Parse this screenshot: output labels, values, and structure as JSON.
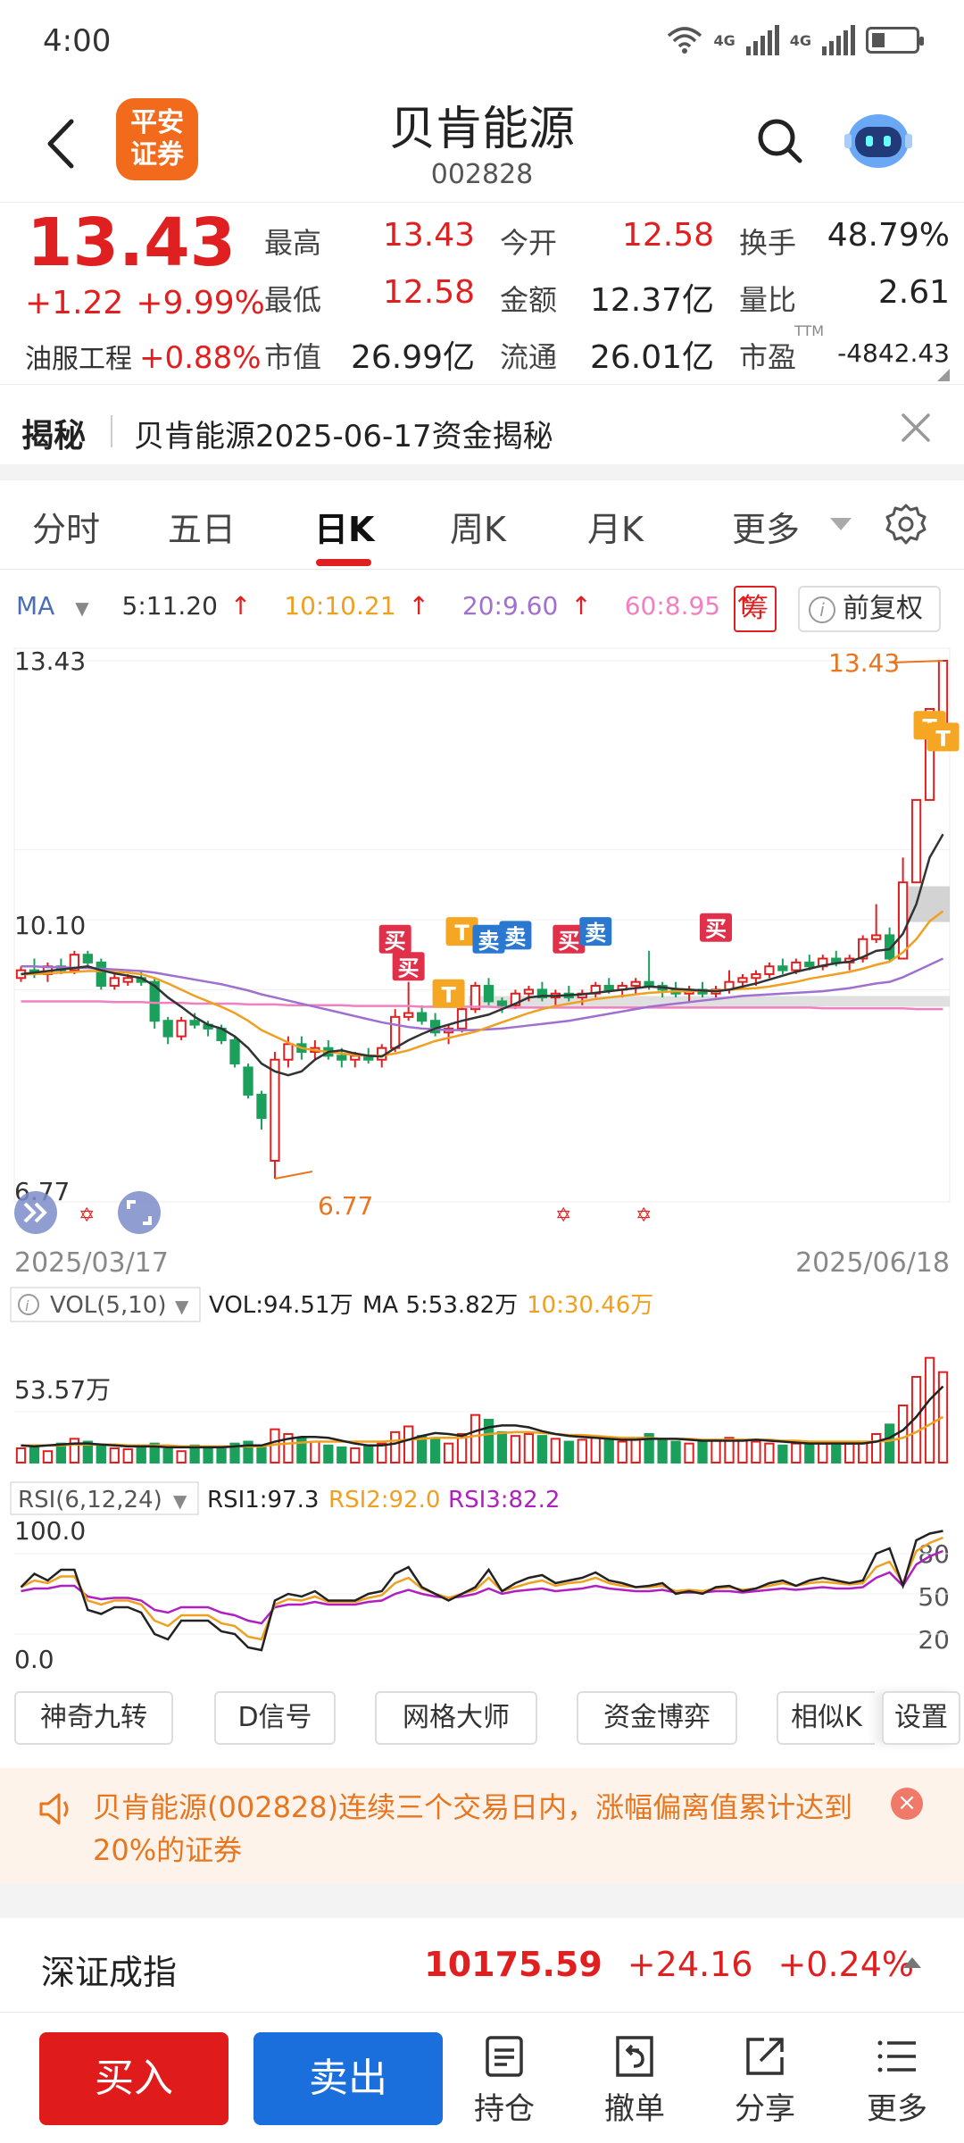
{
  "status": {
    "time": "4:00",
    "net1": "4G",
    "net2": "4G"
  },
  "header": {
    "logo_line1": "平安",
    "logo_line2": "证券",
    "title": "贝肯能源",
    "code": "002828"
  },
  "quote": {
    "price": "13.43",
    "change": "+1.22",
    "change_pct": "+9.99%",
    "sector_name": "油服工程",
    "sector_pct": "+0.88%",
    "fields": [
      {
        "label": "最高",
        "value": "13.43"
      },
      {
        "label": "今开",
        "value": "12.58"
      },
      {
        "label": "换手",
        "value": "48.79%"
      },
      {
        "label": "最低",
        "value": "12.58"
      },
      {
        "label": "金额",
        "value": "12.37亿"
      },
      {
        "label": "量比",
        "value": "2.61"
      },
      {
        "label": "市值",
        "value": "26.99亿"
      },
      {
        "label": "流通",
        "value": "26.01亿"
      },
      {
        "label": "市盈",
        "value": "-4842.43"
      }
    ],
    "pe_sup": "TTM"
  },
  "reveal": {
    "tag": "揭秘",
    "text": "贝肯能源2025-06-17资金揭秘"
  },
  "tabs": [
    "分时",
    "五日",
    "日K",
    "周K",
    "月K",
    "更多"
  ],
  "active_tab": "日K",
  "ma": {
    "label": "MA",
    "ma5": "5:11.20",
    "ma10": "10:10.21",
    "ma20": "20:9.60",
    "ma60": "60:8.95"
  },
  "chart_buttons": {
    "chip": "筹",
    "restore": "前复权"
  },
  "colors": {
    "up": "#e02020",
    "down": "#1aa05a",
    "ma5": "#333333",
    "ma10": "#f0a020",
    "ma20": "#a070d0",
    "ma60": "#f080c0"
  },
  "chart_data": {
    "type": "candlestick",
    "x_start": "2025/03/17",
    "x_end": "2025/06/18",
    "y_max_label": "13.43",
    "y_mid_label": "10.10",
    "y_min_label": "6.77",
    "high_marker": "13.43",
    "low_marker": "6.77",
    "ylim": [
      6.77,
      13.43
    ],
    "ohlc": [
      [
        9.35,
        9.5,
        9.3,
        9.45
      ],
      [
        9.45,
        9.6,
        9.35,
        9.4
      ],
      [
        9.4,
        9.55,
        9.3,
        9.5
      ],
      [
        9.5,
        9.6,
        9.4,
        9.45
      ],
      [
        9.45,
        9.7,
        9.4,
        9.65
      ],
      [
        9.65,
        9.7,
        9.5,
        9.55
      ],
      [
        9.55,
        9.6,
        9.2,
        9.25
      ],
      [
        9.25,
        9.4,
        9.2,
        9.35
      ],
      [
        9.3,
        9.4,
        9.25,
        9.35
      ],
      [
        9.35,
        9.45,
        9.25,
        9.3
      ],
      [
        9.3,
        9.35,
        8.7,
        8.8
      ],
      [
        8.8,
        8.85,
        8.5,
        8.6
      ],
      [
        8.6,
        8.85,
        8.55,
        8.8
      ],
      [
        8.8,
        8.9,
        8.7,
        8.75
      ],
      [
        8.75,
        8.8,
        8.6,
        8.7
      ],
      [
        8.7,
        8.75,
        8.5,
        8.55
      ],
      [
        8.55,
        8.6,
        8.2,
        8.25
      ],
      [
        8.2,
        8.25,
        7.8,
        7.85
      ],
      [
        7.85,
        7.9,
        7.4,
        7.55
      ],
      [
        7.0,
        8.4,
        6.77,
        8.3
      ],
      [
        8.3,
        8.6,
        8.2,
        8.5
      ],
      [
        8.5,
        8.6,
        8.3,
        8.4
      ],
      [
        8.4,
        8.55,
        8.3,
        8.45
      ],
      [
        8.45,
        8.55,
        8.3,
        8.35
      ],
      [
        8.35,
        8.45,
        8.2,
        8.3
      ],
      [
        8.3,
        8.4,
        8.2,
        8.35
      ],
      [
        8.35,
        8.45,
        8.25,
        8.3
      ],
      [
        8.3,
        8.5,
        8.2,
        8.45
      ],
      [
        8.45,
        8.95,
        8.4,
        8.85
      ],
      [
        8.85,
        9.3,
        8.8,
        8.9
      ],
      [
        8.9,
        9.0,
        8.75,
        8.8
      ],
      [
        8.8,
        8.9,
        8.6,
        8.65
      ],
      [
        8.65,
        8.75,
        8.5,
        8.7
      ],
      [
        8.7,
        9.0,
        8.65,
        8.95
      ],
      [
        8.95,
        9.3,
        8.9,
        9.25
      ],
      [
        9.25,
        9.35,
        9.0,
        9.05
      ],
      [
        9.05,
        9.1,
        8.9,
        9.0
      ],
      [
        9.0,
        9.2,
        8.95,
        9.15
      ],
      [
        9.15,
        9.25,
        9.05,
        9.2
      ],
      [
        9.2,
        9.3,
        9.05,
        9.1
      ],
      [
        9.1,
        9.2,
        9.0,
        9.15
      ],
      [
        9.15,
        9.25,
        9.05,
        9.1
      ],
      [
        9.1,
        9.2,
        9.0,
        9.15
      ],
      [
        9.15,
        9.3,
        9.1,
        9.25
      ],
      [
        9.25,
        9.35,
        9.15,
        9.2
      ],
      [
        9.2,
        9.3,
        9.1,
        9.25
      ],
      [
        9.25,
        9.35,
        9.15,
        9.3
      ],
      [
        9.3,
        9.7,
        9.2,
        9.25
      ],
      [
        9.25,
        9.3,
        9.1,
        9.2
      ],
      [
        9.2,
        9.3,
        9.1,
        9.15
      ],
      [
        9.15,
        9.25,
        9.05,
        9.2
      ],
      [
        9.2,
        9.3,
        9.1,
        9.15
      ],
      [
        9.15,
        9.25,
        9.1,
        9.2
      ],
      [
        9.2,
        9.45,
        9.15,
        9.3
      ],
      [
        9.3,
        9.4,
        9.2,
        9.35
      ],
      [
        9.35,
        9.45,
        9.25,
        9.4
      ],
      [
        9.4,
        9.55,
        9.35,
        9.5
      ],
      [
        9.5,
        9.6,
        9.4,
        9.45
      ],
      [
        9.45,
        9.6,
        9.4,
        9.55
      ],
      [
        9.55,
        9.65,
        9.45,
        9.5
      ],
      [
        9.5,
        9.65,
        9.45,
        9.6
      ],
      [
        9.6,
        9.7,
        9.5,
        9.55
      ],
      [
        9.55,
        9.65,
        9.45,
        9.6
      ],
      [
        9.6,
        9.9,
        9.55,
        9.85
      ],
      [
        9.85,
        10.3,
        9.8,
        9.9
      ],
      [
        9.9,
        10.0,
        9.55,
        9.6
      ],
      [
        9.6,
        10.9,
        9.6,
        10.58
      ],
      [
        10.58,
        11.64,
        10.58,
        11.64
      ],
      [
        11.64,
        12.81,
        11.64,
        12.81
      ],
      [
        12.58,
        13.43,
        12.58,
        13.43
      ]
    ],
    "ma5": [
      9.4,
      9.42,
      9.44,
      9.46,
      9.48,
      9.5,
      9.45,
      9.41,
      9.38,
      9.35,
      9.25,
      9.1,
      8.98,
      8.85,
      8.75,
      8.7,
      8.6,
      8.45,
      8.25,
      8.15,
      8.1,
      8.15,
      8.3,
      8.4,
      8.42,
      8.38,
      8.35,
      8.34,
      8.45,
      8.55,
      8.63,
      8.7,
      8.75,
      8.8,
      8.84,
      8.88,
      8.95,
      9.02,
      9.1,
      9.12,
      9.12,
      9.13,
      9.14,
      9.16,
      9.18,
      9.2,
      9.22,
      9.24,
      9.23,
      9.21,
      9.2,
      9.19,
      9.18,
      9.2,
      9.24,
      9.28,
      9.33,
      9.38,
      9.43,
      9.47,
      9.51,
      9.54,
      9.56,
      9.62,
      9.7,
      9.72,
      9.92,
      10.3,
      10.9,
      11.2
    ],
    "ma10": [
      9.4,
      9.4,
      9.41,
      9.42,
      9.43,
      9.44,
      9.44,
      9.43,
      9.42,
      9.4,
      9.35,
      9.28,
      9.2,
      9.12,
      9.05,
      8.98,
      8.9,
      8.8,
      8.68,
      8.6,
      8.52,
      8.45,
      8.42,
      8.4,
      8.38,
      8.36,
      8.35,
      8.35,
      8.38,
      8.42,
      8.48,
      8.54,
      8.58,
      8.62,
      8.66,
      8.72,
      8.78,
      8.84,
      8.9,
      8.95,
      8.99,
      9.02,
      9.05,
      9.08,
      9.1,
      9.12,
      9.14,
      9.16,
      9.17,
      9.18,
      9.18,
      9.19,
      9.19,
      9.2,
      9.21,
      9.22,
      9.24,
      9.27,
      9.3,
      9.34,
      9.37,
      9.4,
      9.43,
      9.47,
      9.52,
      9.56,
      9.68,
      9.85,
      10.08,
      10.21
    ],
    "ma20": [
      9.5,
      9.5,
      9.49,
      9.49,
      9.48,
      9.48,
      9.47,
      9.46,
      9.45,
      9.44,
      9.42,
      9.39,
      9.36,
      9.33,
      9.3,
      9.27,
      9.23,
      9.19,
      9.14,
      9.1,
      9.06,
      9.02,
      8.98,
      8.94,
      8.9,
      8.86,
      8.82,
      8.78,
      8.75,
      8.72,
      8.7,
      8.69,
      8.68,
      8.68,
      8.68,
      8.69,
      8.7,
      8.72,
      8.74,
      8.76,
      8.78,
      8.8,
      8.83,
      8.86,
      8.89,
      8.92,
      8.95,
      8.98,
      9.0,
      9.02,
      9.04,
      9.06,
      9.08,
      9.1,
      9.12,
      9.13,
      9.14,
      9.15,
      9.16,
      9.17,
      9.18,
      9.2,
      9.22,
      9.25,
      9.28,
      9.3,
      9.36,
      9.44,
      9.52,
      9.6
    ],
    "ma60": [
      9.05,
      9.05,
      9.05,
      9.05,
      9.05,
      9.05,
      9.05,
      9.04,
      9.04,
      9.04,
      9.03,
      9.03,
      9.03,
      9.02,
      9.02,
      9.02,
      9.02,
      9.01,
      9.01,
      9.01,
      9.0,
      9.0,
      9.0,
      9.0,
      9.0,
      8.99,
      8.99,
      8.99,
      8.99,
      8.99,
      8.98,
      8.98,
      8.98,
      8.98,
      8.98,
      8.98,
      8.97,
      8.97,
      8.97,
      8.97,
      8.97,
      8.97,
      8.97,
      8.97,
      8.97,
      8.97,
      8.97,
      8.97,
      8.97,
      8.97,
      8.97,
      8.97,
      8.97,
      8.97,
      8.97,
      8.97,
      8.97,
      8.97,
      8.97,
      8.97,
      8.96,
      8.96,
      8.96,
      8.96,
      8.96,
      8.96,
      8.96,
      8.95,
      8.95,
      8.95
    ],
    "signals": [
      {
        "i": 28,
        "text": "买",
        "kind": "buy",
        "price": 9.85
      },
      {
        "i": 29,
        "text": "买",
        "kind": "buy",
        "price": 9.5
      },
      {
        "i": 32,
        "text": "T",
        "kind": "t",
        "price": 9.15
      },
      {
        "i": 33,
        "text": "T",
        "kind": "t",
        "price": 9.95
      },
      {
        "i": 35,
        "text": "卖",
        "kind": "sell",
        "price": 9.85
      },
      {
        "i": 37,
        "text": "卖",
        "kind": "sell",
        "price": 9.9
      },
      {
        "i": 41,
        "text": "买",
        "kind": "buy",
        "price": 9.85
      },
      {
        "i": 43,
        "text": "卖",
        "kind": "sell",
        "price": 9.95
      },
      {
        "i": 52,
        "text": "买",
        "kind": "buy",
        "price": 10.0
      },
      {
        "i": 68,
        "text": "T",
        "kind": "t",
        "price": 12.6
      },
      {
        "i": 69,
        "text": "T",
        "kind": "t",
        "price": 12.45
      }
    ]
  },
  "vol": {
    "selector": "VOL(5,10)",
    "vol": "VOL:94.51万",
    "ma5": "MA 5:53.82万",
    "ma10": "10:30.46万",
    "axis_label": "53.57万",
    "values": [
      15,
      18,
      12,
      20,
      25,
      22,
      18,
      15,
      14,
      16,
      20,
      14,
      12,
      18,
      16,
      14,
      20,
      22,
      18,
      35,
      30,
      25,
      22,
      18,
      16,
      15,
      17,
      20,
      32,
      38,
      28,
      25,
      20,
      30,
      50,
      45,
      32,
      28,
      30,
      28,
      25,
      22,
      24,
      26,
      24,
      22,
      26,
      30,
      24,
      22,
      20,
      22,
      24,
      26,
      24,
      22,
      20,
      18,
      20,
      22,
      20,
      18,
      20,
      22,
      30,
      40,
      60,
      90,
      110,
      95
    ],
    "ma5_line": [
      18,
      17,
      18,
      19,
      20,
      20,
      19,
      18,
      17,
      17,
      17,
      16,
      16,
      16,
      16,
      16,
      17,
      18,
      18,
      22,
      25,
      27,
      27,
      26,
      23,
      20,
      18,
      18,
      20,
      24,
      28,
      31,
      30,
      28,
      33,
      37,
      39,
      39,
      37,
      33,
      30,
      28,
      27,
      26,
      25,
      24,
      24,
      25,
      25,
      25,
      24,
      23,
      23,
      23,
      23,
      24,
      23,
      22,
      21,
      20,
      20,
      20,
      20,
      20,
      22,
      26,
      34,
      48,
      66,
      80
    ],
    "ma10_line": [
      18,
      18,
      18,
      18,
      19,
      19,
      19,
      19,
      18,
      18,
      18,
      18,
      17,
      17,
      17,
      17,
      17,
      17,
      17,
      19,
      20,
      21,
      22,
      22,
      22,
      22,
      22,
      22,
      23,
      24,
      25,
      26,
      26,
      26,
      28,
      30,
      31,
      32,
      32,
      31,
      30,
      29,
      29,
      28,
      27,
      26,
      26,
      26,
      25,
      25,
      25,
      24,
      24,
      24,
      24,
      24,
      24,
      23,
      23,
      22,
      22,
      22,
      22,
      22,
      22,
      23,
      26,
      32,
      40,
      48
    ],
    "max": 120
  },
  "rsi": {
    "selector": "RSI(6,12,24)",
    "rsi1": "RSI1:97.3",
    "rsi2": "RSI2:92.0",
    "rsi3": "RSI3:82.2",
    "top_label": "100.0",
    "bottom_label": "0.0",
    "r80": "80",
    "r50": "50",
    "r20": "20",
    "rsi1_line": [
      55,
      65,
      60,
      68,
      68,
      38,
      35,
      40,
      40,
      36,
      20,
      16,
      30,
      30,
      30,
      22,
      20,
      10,
      8,
      45,
      50,
      48,
      52,
      45,
      45,
      45,
      50,
      52,
      65,
      70,
      55,
      50,
      45,
      50,
      55,
      68,
      52,
      58,
      62,
      64,
      58,
      60,
      62,
      66,
      60,
      58,
      55,
      56,
      58,
      50,
      52,
      50,
      55,
      56,
      52,
      54,
      58,
      60,
      56,
      60,
      62,
      60,
      58,
      60,
      80,
      84,
      56,
      90,
      95,
      97
    ],
    "rsi2_line": [
      55,
      60,
      58,
      63,
      63,
      45,
      42,
      45,
      45,
      42,
      30,
      26,
      34,
      34,
      34,
      28,
      26,
      18,
      16,
      42,
      46,
      45,
      48,
      44,
      44,
      44,
      47,
      49,
      58,
      62,
      54,
      50,
      47,
      50,
      53,
      62,
      52,
      55,
      58,
      60,
      56,
      58,
      59,
      62,
      58,
      56,
      55,
      55,
      56,
      52,
      53,
      52,
      54,
      55,
      53,
      54,
      56,
      58,
      56,
      58,
      59,
      58,
      57,
      58,
      70,
      74,
      58,
      82,
      88,
      92
    ],
    "rsi3_line": [
      52,
      54,
      54,
      56,
      56,
      48,
      46,
      47,
      47,
      45,
      38,
      36,
      40,
      40,
      40,
      36,
      34,
      30,
      28,
      40,
      42,
      42,
      44,
      42,
      42,
      42,
      44,
      45,
      50,
      53,
      50,
      48,
      47,
      48,
      50,
      54,
      50,
      52,
      53,
      54,
      52,
      53,
      54,
      56,
      54,
      53,
      52,
      52,
      53,
      51,
      51,
      51,
      52,
      52,
      51,
      52,
      53,
      54,
      53,
      54,
      55,
      54,
      54,
      55,
      62,
      66,
      56,
      72,
      78,
      82
    ]
  },
  "tools": [
    "神奇九转",
    "D信号",
    "网格大师",
    "资金博弈",
    "相似K",
    "设置"
  ],
  "alert": {
    "text": "贝肯能源(002828)连续三个交易日内，涨幅偏离值累计达到20%的证券",
    "close": "×"
  },
  "index": {
    "name": "深证成指",
    "value": "10175.59",
    "change": "+24.16",
    "pct": "+0.24%"
  },
  "nav": {
    "buy": "买入",
    "sell": "卖出",
    "hold": "持仓",
    "cancel": "撤单",
    "share": "分享",
    "more": "更多"
  }
}
